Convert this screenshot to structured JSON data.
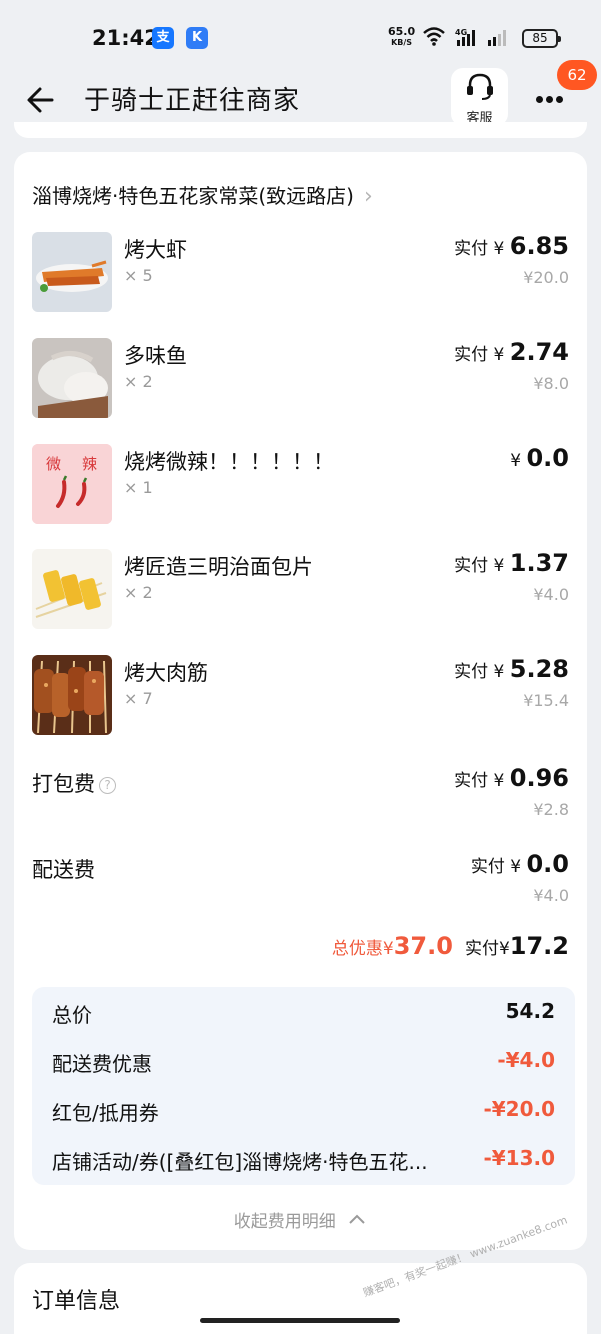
{
  "status_bar": {
    "time": "21:42",
    "app_icon_1": "支",
    "app_icon_2": "K",
    "net_speed": "65.0",
    "net_unit": "KB/S",
    "signal_tag": "4G",
    "battery": "85"
  },
  "nav": {
    "title": "于骑士正赶往商家",
    "service_label": "客服",
    "badge_count": "62"
  },
  "store": {
    "name": "淄博烧烤·特色五花家常菜(致远路店)",
    "chevron": "›"
  },
  "items": [
    {
      "name": "烤大虾",
      "qty": "× 5",
      "pay_label": "实付 ¥ ",
      "pay_value": "6.85",
      "original": "¥20.0",
      "thumb": "shrimp"
    },
    {
      "name": "多味鱼",
      "qty": "× 2",
      "pay_label": "实付 ¥ ",
      "pay_value": "2.74",
      "original": "¥8.0",
      "thumb": "fish"
    },
    {
      "name": "烧烤微辣！！！！！！",
      "qty": "× 1",
      "pay_label": "¥ ",
      "pay_value": "0.0",
      "original": "",
      "thumb": "chili",
      "thumb_text_1": "微",
      "thumb_text_2": "辣"
    },
    {
      "name": "烤匠造三明治面包片",
      "qty": "× 2",
      "pay_label": "实付 ¥ ",
      "pay_value": "1.37",
      "original": "¥4.0",
      "thumb": "bread"
    },
    {
      "name": "烤大肉筋",
      "qty": "× 7",
      "pay_label": "实付 ¥ ",
      "pay_value": "5.28",
      "original": "¥15.4",
      "thumb": "skewers"
    }
  ],
  "fees": [
    {
      "label": "打包费",
      "help": "?",
      "pay_label": "实付 ¥ ",
      "pay_value": "0.96",
      "original": "¥2.8"
    },
    {
      "label": "配送费",
      "pay_label": "实付 ¥ ",
      "pay_value": "0.0",
      "original": "¥4.0"
    }
  ],
  "summary": {
    "discount_label": "总优惠¥",
    "discount_value": "37.0",
    "paid_label": "实付¥",
    "paid_value": "17.2"
  },
  "breakdown": [
    {
      "label": "总价",
      "value": "54.2"
    },
    {
      "label": "配送费优惠",
      "value": "-¥4.0"
    },
    {
      "label": "红包/抵用券",
      "value": "-¥20.0"
    },
    {
      "label": "店铺活动/券([叠红包]淄博烧烤·特色五花...",
      "value": "-¥13.0"
    }
  ],
  "collapse_label": "收起费用明细",
  "order_info_title": "订单信息",
  "watermark": "赚客吧，有奖一起赚！ www.zuanke8.com",
  "colors": {
    "accent_red": "#f05a3c",
    "badge": "#ff5722",
    "breakdown_bg": "#f1f5fb"
  }
}
